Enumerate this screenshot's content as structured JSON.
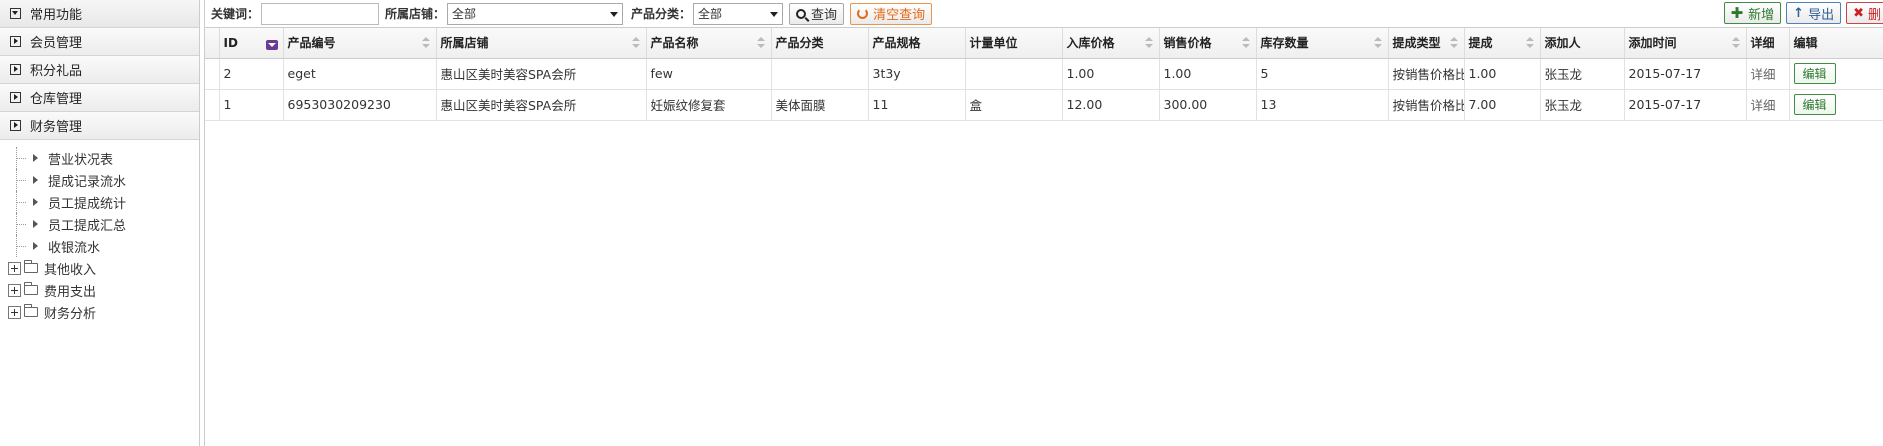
{
  "sidebar": {
    "sections": [
      {
        "label": "常用功能",
        "icon": "collapse-down-icon"
      },
      {
        "label": "会员管理",
        "icon": "expand-right-icon"
      },
      {
        "label": "积分礼品",
        "icon": "expand-right-icon"
      },
      {
        "label": "仓库管理",
        "icon": "expand-right-icon"
      },
      {
        "label": "财务管理",
        "icon": "expand-right-icon"
      }
    ],
    "tree": {
      "leaves": [
        "营业状况表",
        "提成记录流水",
        "员工提成统计",
        "员工提成汇总",
        "收银流水"
      ],
      "folders": [
        "其他收入",
        "费用支出",
        "财务分析"
      ]
    }
  },
  "toolbar": {
    "keyword_label": "关键词：",
    "keyword_value": "",
    "store_label": "所属店铺：",
    "store_selected": "全部",
    "category_label": "产品分类：",
    "category_selected": "全部",
    "search_label": "查询",
    "clear_label": "清空查询",
    "add_label": "新增",
    "export_label": "导出",
    "delete_label": "删"
  },
  "grid": {
    "columns": [
      "ID",
      "产品编号",
      "所属店铺",
      "产品名称",
      "产品分类",
      "产品规格",
      "计量单位",
      "入库价格",
      "销售价格",
      "库存数量",
      "提成类型",
      "提成",
      "添加人",
      "添加时间",
      "详细",
      "编辑"
    ],
    "rows": [
      {
        "id": "2",
        "code": "eget",
        "store": "惠山区美时美容SPA会所",
        "name": "few",
        "category": "",
        "spec": "3t3y",
        "unit": "",
        "in_price": "1.00",
        "sale_price": "1.00",
        "stock": "5",
        "comm_type": "按销售价格比例",
        "comm": "1.00",
        "adder": "张玉龙",
        "date": "2015-07-17",
        "detail": "详细",
        "edit": "编辑"
      },
      {
        "id": "1",
        "code": "6953030209230",
        "store": "惠山区美时美容SPA会所",
        "name": "妊娠纹修复套",
        "category": "美体面膜",
        "spec": "11",
        "unit": "盒",
        "in_price": "12.00",
        "sale_price": "300.00",
        "stock": "13",
        "comm_type": "按销售价格比例",
        "comm": "7.00",
        "adder": "张玉龙",
        "date": "2015-07-17",
        "detail": "详细",
        "edit": "编辑"
      }
    ]
  }
}
